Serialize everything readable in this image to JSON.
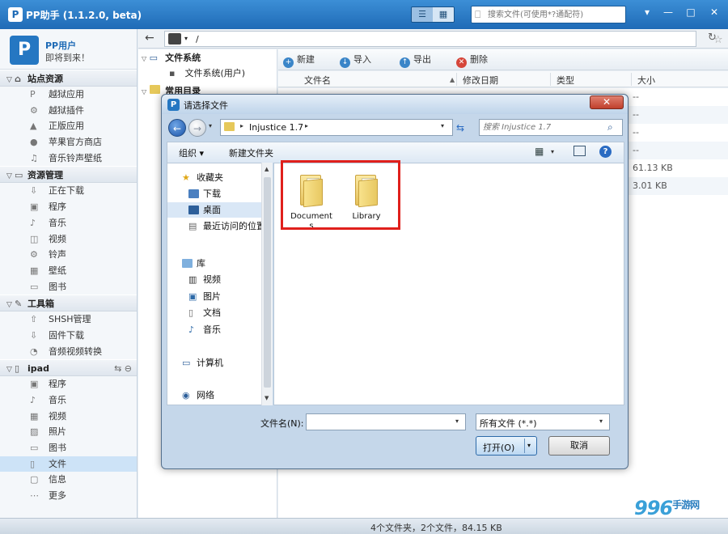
{
  "app": {
    "title": "PP助手 (1.1.2.0, beta)",
    "logo": "P",
    "search_placeholder": "搜索文件(可使用*?通配符)",
    "view_toggle": [
      "☰",
      "▦"
    ],
    "win_buttons": [
      "▾",
      "—",
      "□",
      "✕"
    ]
  },
  "user": {
    "name": "PP用户",
    "status": "即将到来！",
    "avatar": "P"
  },
  "sidebar": {
    "sections": [
      {
        "title": "站点资源",
        "items": [
          "越狱应用",
          "越狱插件",
          "正版应用",
          "苹果官方商店",
          "音乐铃声壁纸"
        ]
      },
      {
        "title": "资源管理",
        "items": [
          "正在下载",
          "程序",
          "音乐",
          "视频",
          "铃声",
          "壁纸",
          "图书"
        ]
      },
      {
        "title": "工具箱",
        "items": [
          "SHSH管理",
          "固件下载",
          "音频视频转换"
        ]
      },
      {
        "title": "ipad",
        "items": [
          "程序",
          "音乐",
          "视频",
          "照片",
          "图书",
          "文件",
          "信息",
          "更多"
        ]
      }
    ],
    "icons": [
      "P",
      "⚙",
      "▲",
      "",
      "♫",
      "⇩",
      "▣",
      "♪",
      "◫",
      "⚙",
      "▦",
      "▭",
      "⇧",
      "⇩",
      "◔",
      "▣",
      "♪",
      "▦",
      "▨",
      "▭",
      "▯",
      "▢",
      "⋯"
    ]
  },
  "address": {
    "path": "/"
  },
  "tree": {
    "items": [
      "文件系统",
      "文件系统(用户)",
      "常用目录"
    ]
  },
  "toolbar": {
    "new": "新建",
    "import": "导入",
    "export": "导出",
    "delete": "删除"
  },
  "list": {
    "columns": [
      "文件名",
      "修改日期",
      "类型",
      "大小"
    ],
    "rows": [
      {
        "size": "--"
      },
      {
        "size": "--"
      },
      {
        "size": "--"
      },
      {
        "size": "--"
      },
      {
        "size": "61.13 KB"
      },
      {
        "size": "3.01 KB"
      }
    ]
  },
  "status": {
    "text": "4个文件夹，2个文件，84.15 KB"
  },
  "watermark": {
    "brand": "996",
    "sub": "手游网"
  },
  "dialog": {
    "title": "请选择文件",
    "close": "✕",
    "path": "Injustice 1.7",
    "search_placeholder": "搜索 Injustice 1.7",
    "organize": "组织 ▾",
    "new_folder": "新建文件夹",
    "nav": {
      "favorites": "收藏夹",
      "downloads": "下载",
      "desktop": "桌面",
      "recent": "最近访问的位置",
      "libraries": "库",
      "videos": "视频",
      "pictures": "图片",
      "documents": "文档",
      "music": "音乐",
      "computer": "计算机",
      "network": "网络"
    },
    "folders": [
      "Documents",
      "Library"
    ],
    "filename_label": "文件名(N):",
    "filename_value": "",
    "filetype": "所有文件 (*.*)",
    "open": "打开(O)",
    "cancel": "取消"
  }
}
